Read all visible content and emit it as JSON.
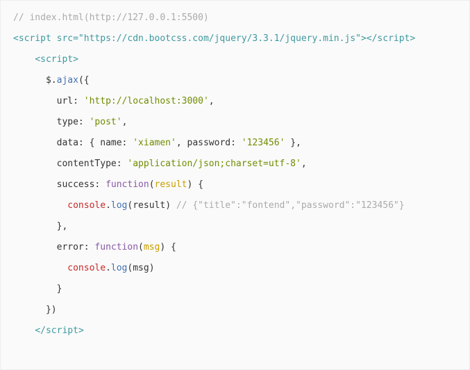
{
  "code": {
    "l1_comment": "// index.html(http://127.0.0.1:5500)",
    "l2_open_lt": "<",
    "l2_tag": "script src",
    "l2_eq": "=\"",
    "l2_src": "https://cdn.bootcss.com/jquery/3.3.1/jquery.min.js",
    "l2_close1": "\">",
    "l2_close_lt": "</",
    "l2_closetag": "script",
    "l2_gt": ">",
    "l3_open_lt": "<",
    "l3_open_tag": "script",
    "l3_open_gt": ">",
    "l4_dollar": "$.",
    "l4_ajax": "ajax",
    "l4_open": "({",
    "l5_key": "url:",
    "l5_val": "'http://localhost:3000'",
    "l5_comma": ",",
    "l6_key": "type:",
    "l6_val": "'post'",
    "l6_comma": ",",
    "l7_key": "data:",
    "l7_open": " {",
    "l7_name_k": " name:",
    "l7_name_v": " 'xiamen'",
    "l7_mid": ",",
    "l7_pw_k": " password:",
    "l7_pw_v": " '123456'",
    "l7_close": " },",
    "l8_key": "contentType:",
    "l8_val": "'application/json;charset=utf-8'",
    "l8_comma": ",",
    "l9_key": "success:",
    "l9_fn": " function",
    "l9_p1": "(",
    "l9_param": "result",
    "l9_p2": ")",
    "l9_brace": " {",
    "l10_console": "console",
    "l10_dot": ".",
    "l10_log": "log",
    "l10_p1": "(",
    "l10_arg": "result",
    "l10_p2": ")",
    "l10_sp": " ",
    "l10_comment": "// {\"title\":\"fontend\",\"password\":\"123456\"}",
    "l11_close": "},",
    "l12_key": "error:",
    "l12_fn": " function",
    "l12_p1": "(",
    "l12_param": "msg",
    "l12_p2": ")",
    "l12_brace": " {",
    "l13_console": "console",
    "l13_dot": ".",
    "l13_log": "log",
    "l13_p1": "(",
    "l13_arg": "msg",
    "l13_p2": ")",
    "l14_close": "}",
    "l15_close": "})",
    "l16_open_lt": "</",
    "l16_tag": "script",
    "l16_gt": ">"
  }
}
